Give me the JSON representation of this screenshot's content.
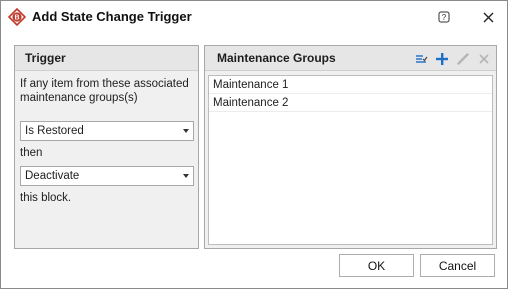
{
  "window": {
    "title": "Add State Change Trigger",
    "app_icon": "b-logo-icon",
    "help_icon": "help-icon",
    "close_icon": "close-icon"
  },
  "trigger_panel": {
    "header": "Trigger",
    "description": "If any item from these associated maintenance groups(s)",
    "condition_value": "Is Restored",
    "then_label": "then",
    "action_value": "Deactivate",
    "suffix_label": "this block."
  },
  "groups_panel": {
    "header": "Maintenance Groups",
    "toolbar_icons": [
      "select-items-icon",
      "add-icon",
      "edit-icon",
      "delete-icon"
    ],
    "items": [
      "Maintenance 1",
      "Maintenance 2"
    ]
  },
  "footer": {
    "ok_label": "OK",
    "cancel_label": "Cancel"
  },
  "colors": {
    "accent_blue": "#1e6fc7",
    "logo_red": "#c0392b",
    "disabled_gray": "#b5b5b5"
  }
}
